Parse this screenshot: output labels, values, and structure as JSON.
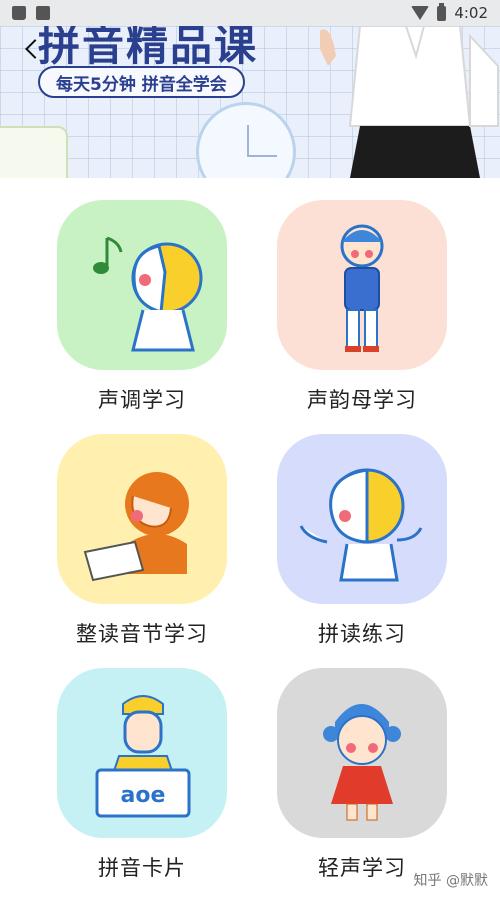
{
  "status_bar": {
    "time": "4:02"
  },
  "banner": {
    "title": "拼音精品课",
    "subtitle": "每天5分钟 拼音全学会"
  },
  "tiles": [
    {
      "label": "声调学习",
      "icon": "child-singing-icon",
      "bg": "#c9f2c4"
    },
    {
      "label": "声韵母学习",
      "icon": "boy-standing-icon",
      "bg": "#fde0d5"
    },
    {
      "label": "整读音节学习",
      "icon": "child-writing-icon",
      "bg": "#fff0b0"
    },
    {
      "label": "拼读练习",
      "icon": "child-waving-icon",
      "bg": "#d6dcfc"
    },
    {
      "label": "拼音卡片",
      "icon": "boy-holding-card-icon",
      "bg": "#c6f1f4",
      "card_text": "aoe"
    },
    {
      "label": "轻声学习",
      "icon": "girl-dancing-icon",
      "bg": "#d9d9d9"
    }
  ],
  "watermark": "知乎 @默默"
}
